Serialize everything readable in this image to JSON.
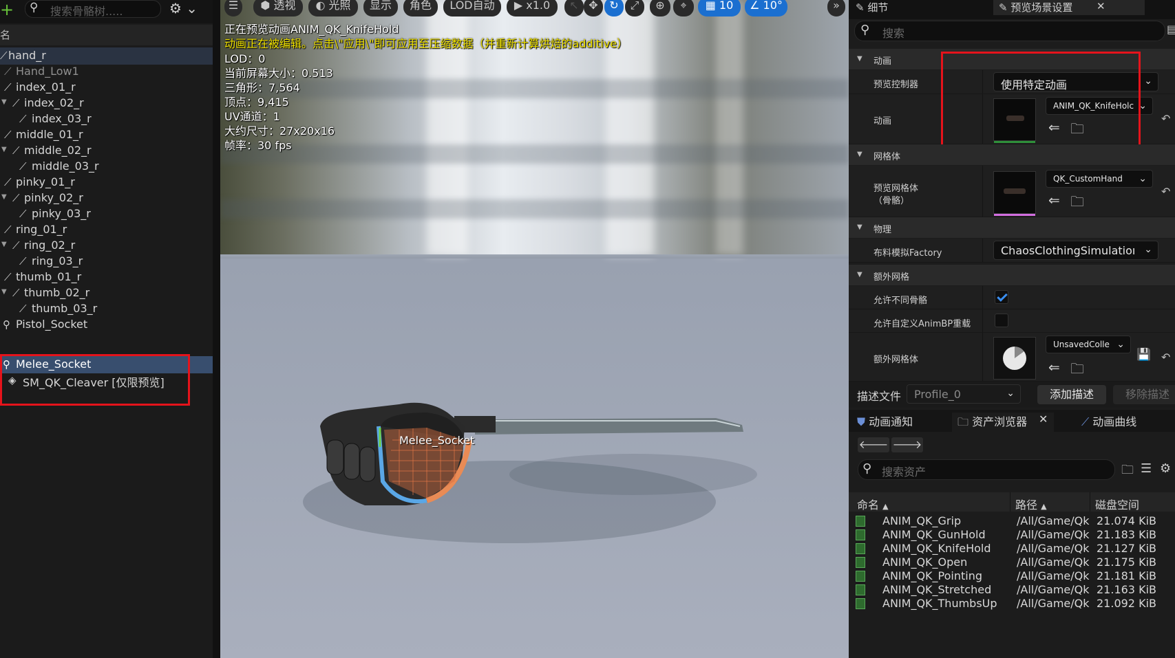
{
  "left": {
    "search_placeholder": "搜索骨骼树.....",
    "column_header": "名",
    "rows": [
      {
        "label": "hand_r"
      },
      {
        "label": "Hand_Low1"
      },
      {
        "label": "index_01_r"
      },
      {
        "label": "index_02_r"
      },
      {
        "label": "index_03_r"
      },
      {
        "label": "middle_01_r"
      },
      {
        "label": "middle_02_r"
      },
      {
        "label": "middle_03_r"
      },
      {
        "label": "pinky_01_r"
      },
      {
        "label": "pinky_02_r"
      },
      {
        "label": "pinky_03_r"
      },
      {
        "label": "ring_01_r"
      },
      {
        "label": "ring_02_r"
      },
      {
        "label": "ring_03_r"
      },
      {
        "label": "thumb_01_r"
      },
      {
        "label": "thumb_02_r"
      },
      {
        "label": "thumb_03_r"
      },
      {
        "label": "Pistol_Socket"
      },
      {
        "label": "Melee_Socket"
      },
      {
        "label": "SM_QK_Cleaver [仅限预览]"
      }
    ]
  },
  "viewport": {
    "toolbar": {
      "perspective": "透视",
      "lighting": "光照",
      "show": "显示",
      "character": "角色",
      "lod": "LOD自动",
      "play_speed": "x1.0",
      "grid_size": "10",
      "angle": "10°"
    },
    "overlay": {
      "line1": "正在预览动画ANIM_QK_KnifeHold",
      "line2": "动画正在被编辑。点击\\\"应用\\\"即可应用至压缩数据（并重新计算烘焙的additive）",
      "line3": "LOD：0",
      "line4": "当前屏幕大小：0.513",
      "line5": "三角形：7,564",
      "line6": "顶点：9,415",
      "line7": "UV通道：1",
      "line8": "大约尺寸：27x20x16",
      "line9": "帧率：30 fps"
    },
    "socket_label": "Melee_Socket"
  },
  "right": {
    "tabs": {
      "details": "细节",
      "preview_scene": "预览场景设置"
    },
    "search_placeholder": "搜索",
    "sections": {
      "animation": "动画",
      "mesh": "网格体",
      "physics": "物理",
      "extra_mesh": "额外网格"
    },
    "props": {
      "preview_controller_label": "预览控制器",
      "preview_controller_value": "使用特定动画",
      "animation_label": "动画",
      "animation_value": "ANIM_QK_KnifeHolc",
      "preview_mesh_label": "预览网格体\n（骨骼）",
      "preview_mesh_label1": "预览网格体",
      "preview_mesh_label2": "（骨骼）",
      "preview_mesh_value": "QK_CustomHand",
      "cloth_label": "布料模拟Factory",
      "cloth_value": "ChaosClothingSimulatioı",
      "allow_diff_skel_label": "允许不同骨骼",
      "allow_custom_bp_label": "允许自定义AnimBP重载",
      "extra_mesh_label": "额外网格体",
      "extra_mesh_value": "UnsavedColle"
    },
    "profile": {
      "label": "描述文件",
      "value": "Profile_0",
      "add": "添加描述",
      "remove": "移除描述"
    },
    "bottom_tabs": {
      "anim_notify": "动画通知",
      "asset_browser": "资产浏览器",
      "anim_curves": "动画曲线"
    },
    "asset_search_placeholder": "搜索资产",
    "table": {
      "headers": {
        "name": "命名",
        "path": "路径",
        "disk": "磁盘空间"
      },
      "rows": [
        {
          "name": "ANIM_QK_Grip",
          "path": "/All/Game/Qk",
          "size": "21.074 KiB"
        },
        {
          "name": "ANIM_QK_GunHold",
          "path": "/All/Game/Qk",
          "size": "21.183 KiB"
        },
        {
          "name": "ANIM_QK_KnifeHold",
          "path": "/All/Game/Qk",
          "size": "21.127 KiB"
        },
        {
          "name": "ANIM_QK_Open",
          "path": "/All/Game/Qk",
          "size": "21.175 KiB"
        },
        {
          "name": "ANIM_QK_Pointing",
          "path": "/All/Game/Qk",
          "size": "21.181 KiB"
        },
        {
          "name": "ANIM_QK_Stretched",
          "path": "/All/Game/Qk",
          "size": "21.163 KiB"
        },
        {
          "name": "ANIM_QK_ThumbsUp",
          "path": "/All/Game/Qk",
          "size": "21.092 KiB"
        }
      ]
    }
  },
  "colors": {
    "highlight_box": "#e5131b",
    "selection": "#384e6e",
    "accent_blue": "#1b6fd0"
  }
}
